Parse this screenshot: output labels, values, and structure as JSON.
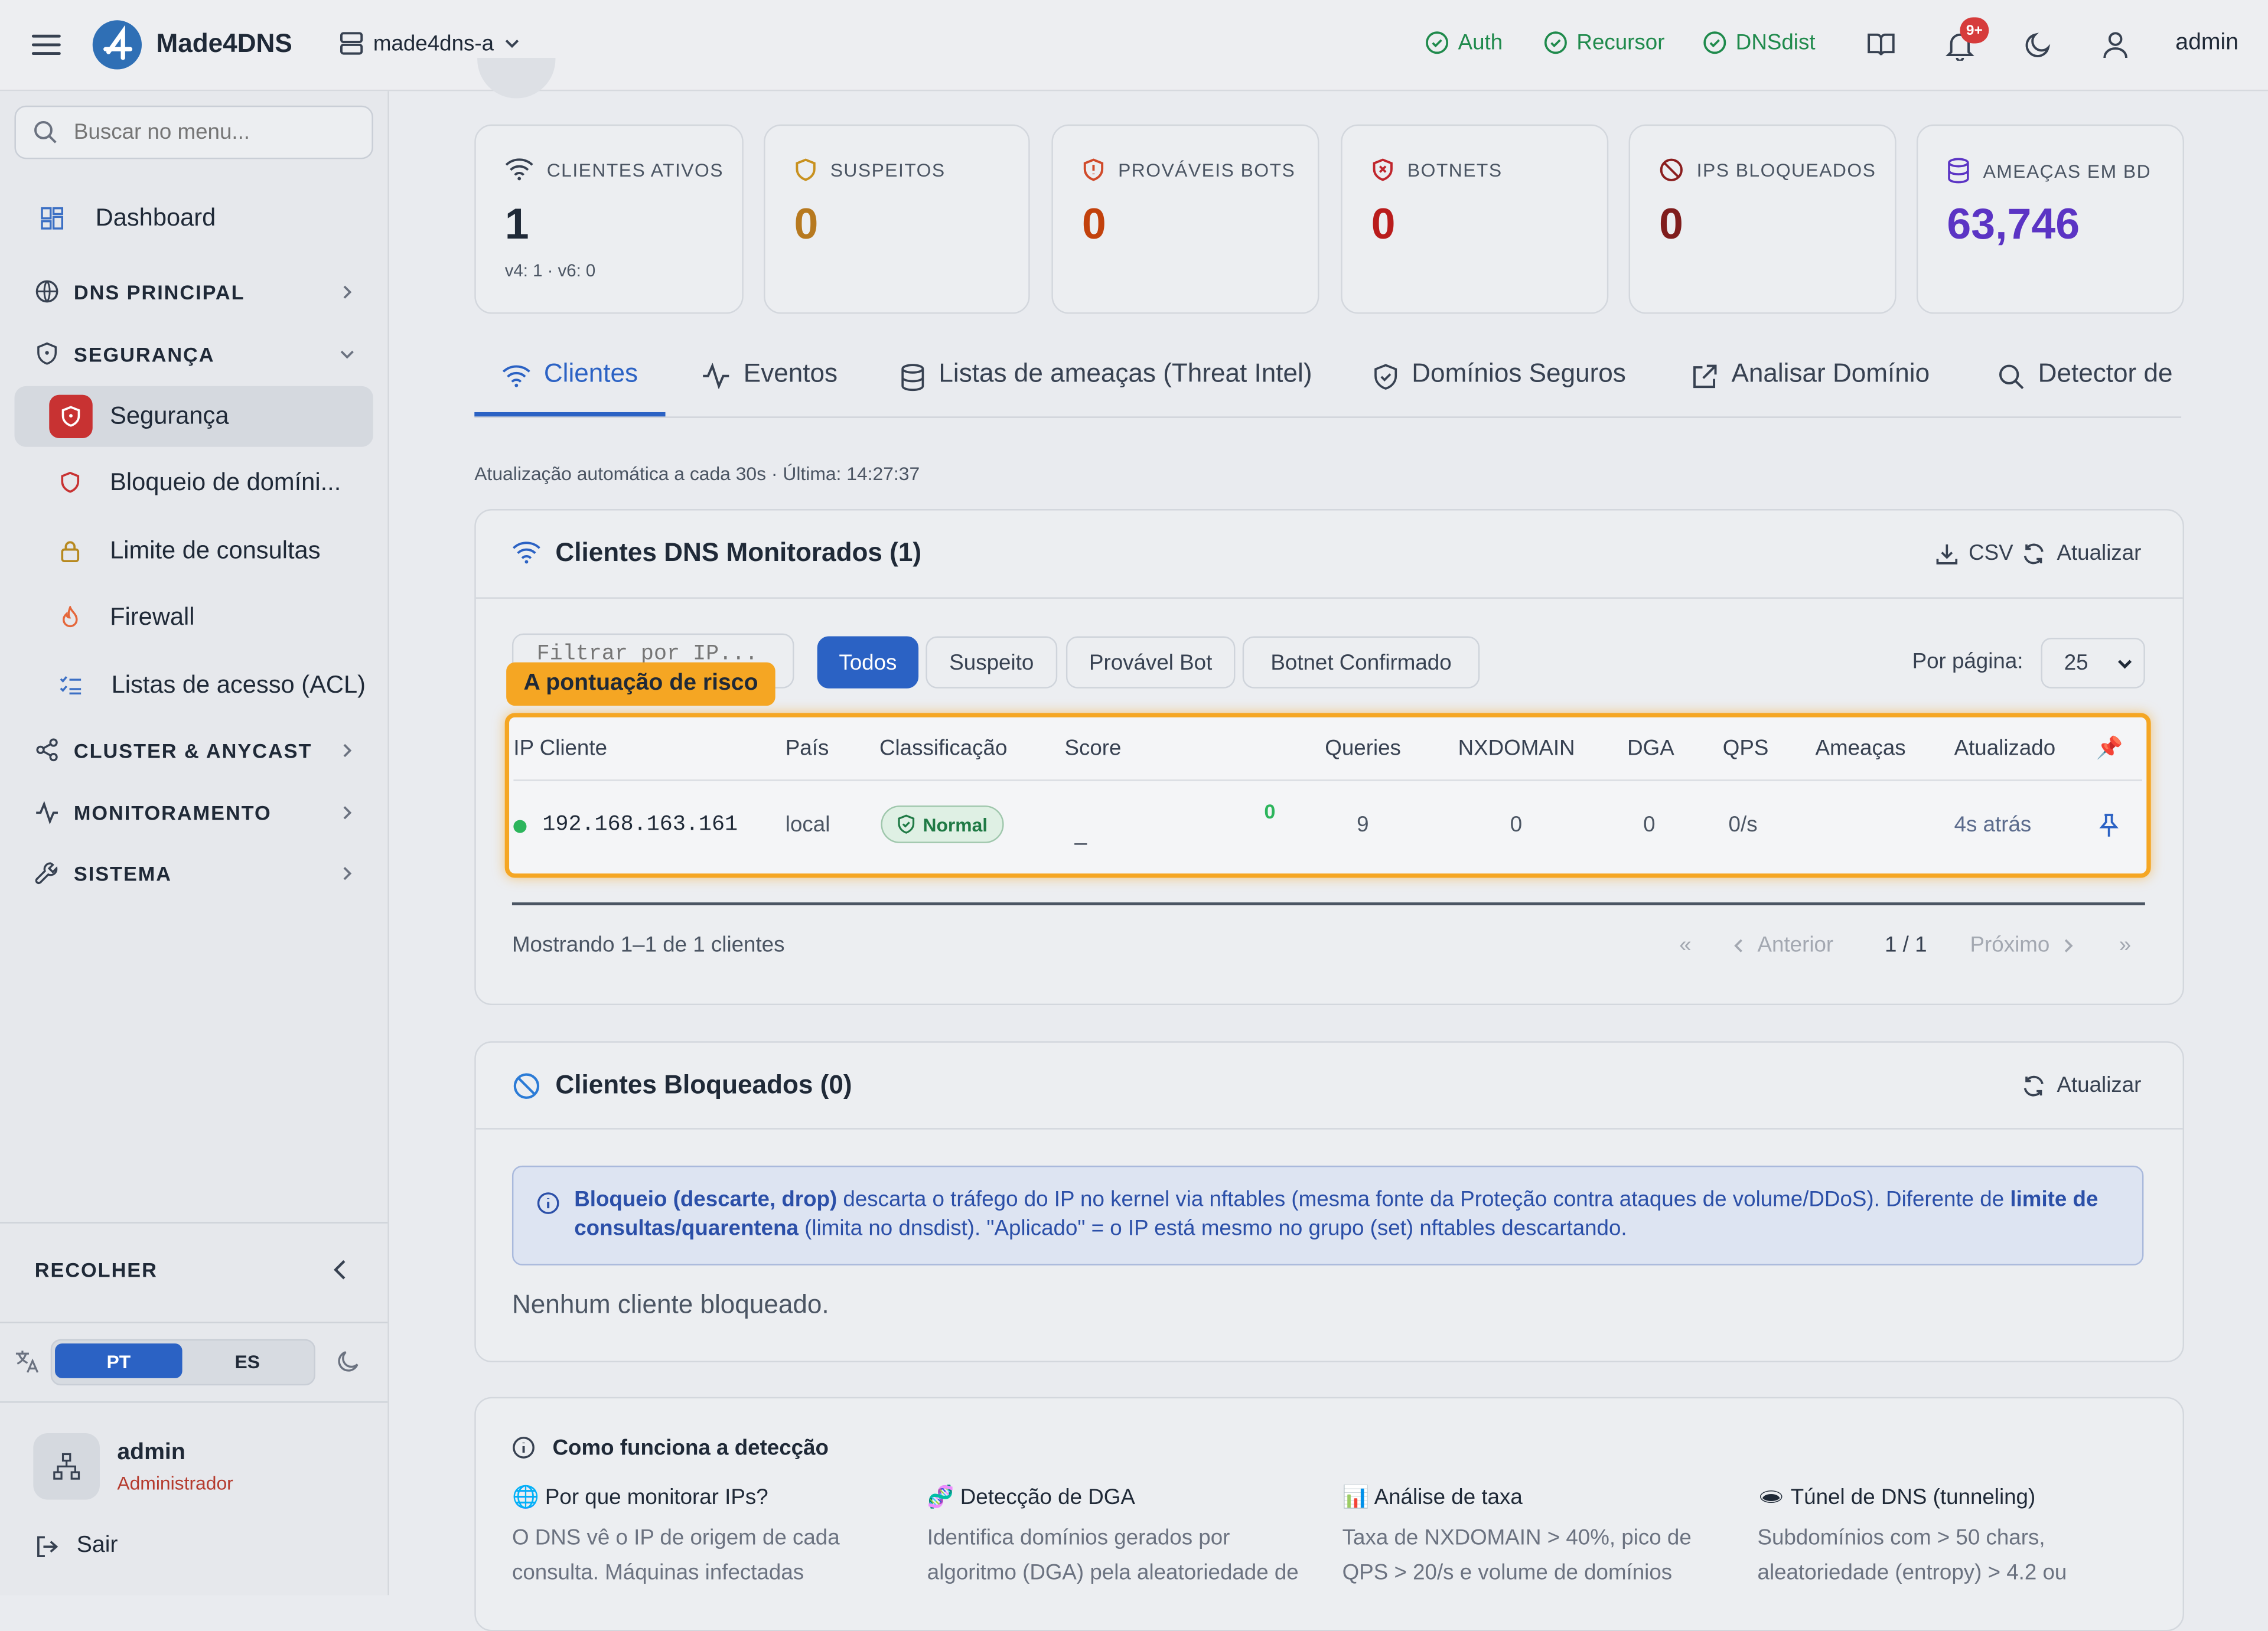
{
  "topbar": {
    "app_name": "Made4DNS",
    "server": "made4dns-a",
    "services": [
      "Auth",
      "Recursor",
      "DNSdist"
    ],
    "notification_badge": "9+",
    "user": "admin"
  },
  "sidebar": {
    "search_placeholder": "Buscar no menu...",
    "dashboard": "Dashboard",
    "sections": {
      "dns_principal": "DNS PRINCIPAL",
      "seguranca": "SEGURANÇA",
      "cluster": "CLUSTER & ANYCAST",
      "monitoramento": "MONITORAMENTO",
      "sistema": "SISTEMA"
    },
    "security_items": [
      "Segurança",
      "Bloqueio de domíni...",
      "Limite de consultas",
      "Firewall",
      "Listas de acesso (ACL)"
    ],
    "collapse_label": "RECOLHER",
    "languages": [
      "PT",
      "ES"
    ],
    "user_name": "admin",
    "user_role": "Administrador",
    "logout": "Sair"
  },
  "stats": [
    {
      "label": "CLIENTES ATIVOS",
      "value": "1",
      "sub": "v4: 1 · v6: 0",
      "color": "#1f2937"
    },
    {
      "label": "SUSPEITOS",
      "value": "0",
      "color": "#b7791f"
    },
    {
      "label": "PROVÁVEIS BOTS",
      "value": "0",
      "color": "#c2410c"
    },
    {
      "label": "BOTNETS",
      "value": "0",
      "color": "#b91c1c"
    },
    {
      "label": "IPS BLOQUEADOS",
      "value": "0",
      "color": "#7f1d1d"
    },
    {
      "label": "AMEAÇAS EM BD",
      "value": "63,746",
      "color": "#5b34c4"
    }
  ],
  "tabs": [
    "Clientes",
    "Eventos",
    "Listas de ameaças (Threat Intel)",
    "Domínios Seguros",
    "Analisar Domínio",
    "Detector de"
  ],
  "auto_refresh": "Atualização automática a cada 30s · Última: 14:27:37",
  "clients": {
    "title": "Clientes DNS Monitorados (1)",
    "csv": "CSV",
    "refresh": "Atualizar",
    "filter_placeholder": "Filtrar por IP...",
    "filters": [
      "Todos",
      "Suspeito",
      "Provável Bot",
      "Botnet Confirmado"
    ],
    "per_page_label": "Por página:",
    "per_page_value": "25",
    "tooltip": "A pontuação de risco",
    "columns": [
      "IP Cliente",
      "País",
      "Classificação",
      "Score",
      "Queries",
      "NXDOMAIN",
      "DGA",
      "QPS",
      "Ameaças",
      "Atualizado"
    ],
    "row": {
      "ip": "192.168.163.161",
      "country": "local",
      "classification": "Normal",
      "score_value": "0",
      "score_bar": "_",
      "queries": "9",
      "nxdomain": "0",
      "dga": "0",
      "qps": "0/s",
      "threats": "",
      "updated": "4s atrás"
    },
    "showing": "Mostrando 1–1 de 1 clientes",
    "pagination": {
      "first": "«",
      "prev": "Anterior",
      "page": "1 / 1",
      "next": "Próximo",
      "last": "»"
    }
  },
  "blocked": {
    "title": "Clientes Bloqueados (0)",
    "refresh": "Atualizar",
    "info_strong1": "Bloqueio (descarte, drop)",
    "info_text1": " descarta o tráfego do IP no kernel via nftables (mesma fonte da Proteção contra ataques de volume/DDoS). Diferente de ",
    "info_strong2": "limite de consultas/quarentena",
    "info_text2": " (limita no dnsdist). \"Aplicado\" = o IP está mesmo no grupo (set) nftables descartando.",
    "empty": "Nenhum cliente bloqueado."
  },
  "how": {
    "title": "Como funciona a detecção",
    "items": [
      {
        "title": "🌐 Por que monitorar IPs?",
        "text": "O DNS vê o IP de origem de cada consulta. Máquinas infectadas"
      },
      {
        "title": "🧬 Detecção de DGA",
        "text": "Identifica domínios gerados por algoritmo (DGA) pela aleatoriedade de"
      },
      {
        "title": "📊 Análise de taxa",
        "text": "Taxa de NXDOMAIN > 40%, pico de QPS > 20/s e volume de domínios"
      },
      {
        "title": "🕳 Túnel de DNS (tunneling)",
        "text": "Subdomínios com > 50 chars, aleatoriedade (entropy) > 4.2 ou"
      }
    ]
  }
}
